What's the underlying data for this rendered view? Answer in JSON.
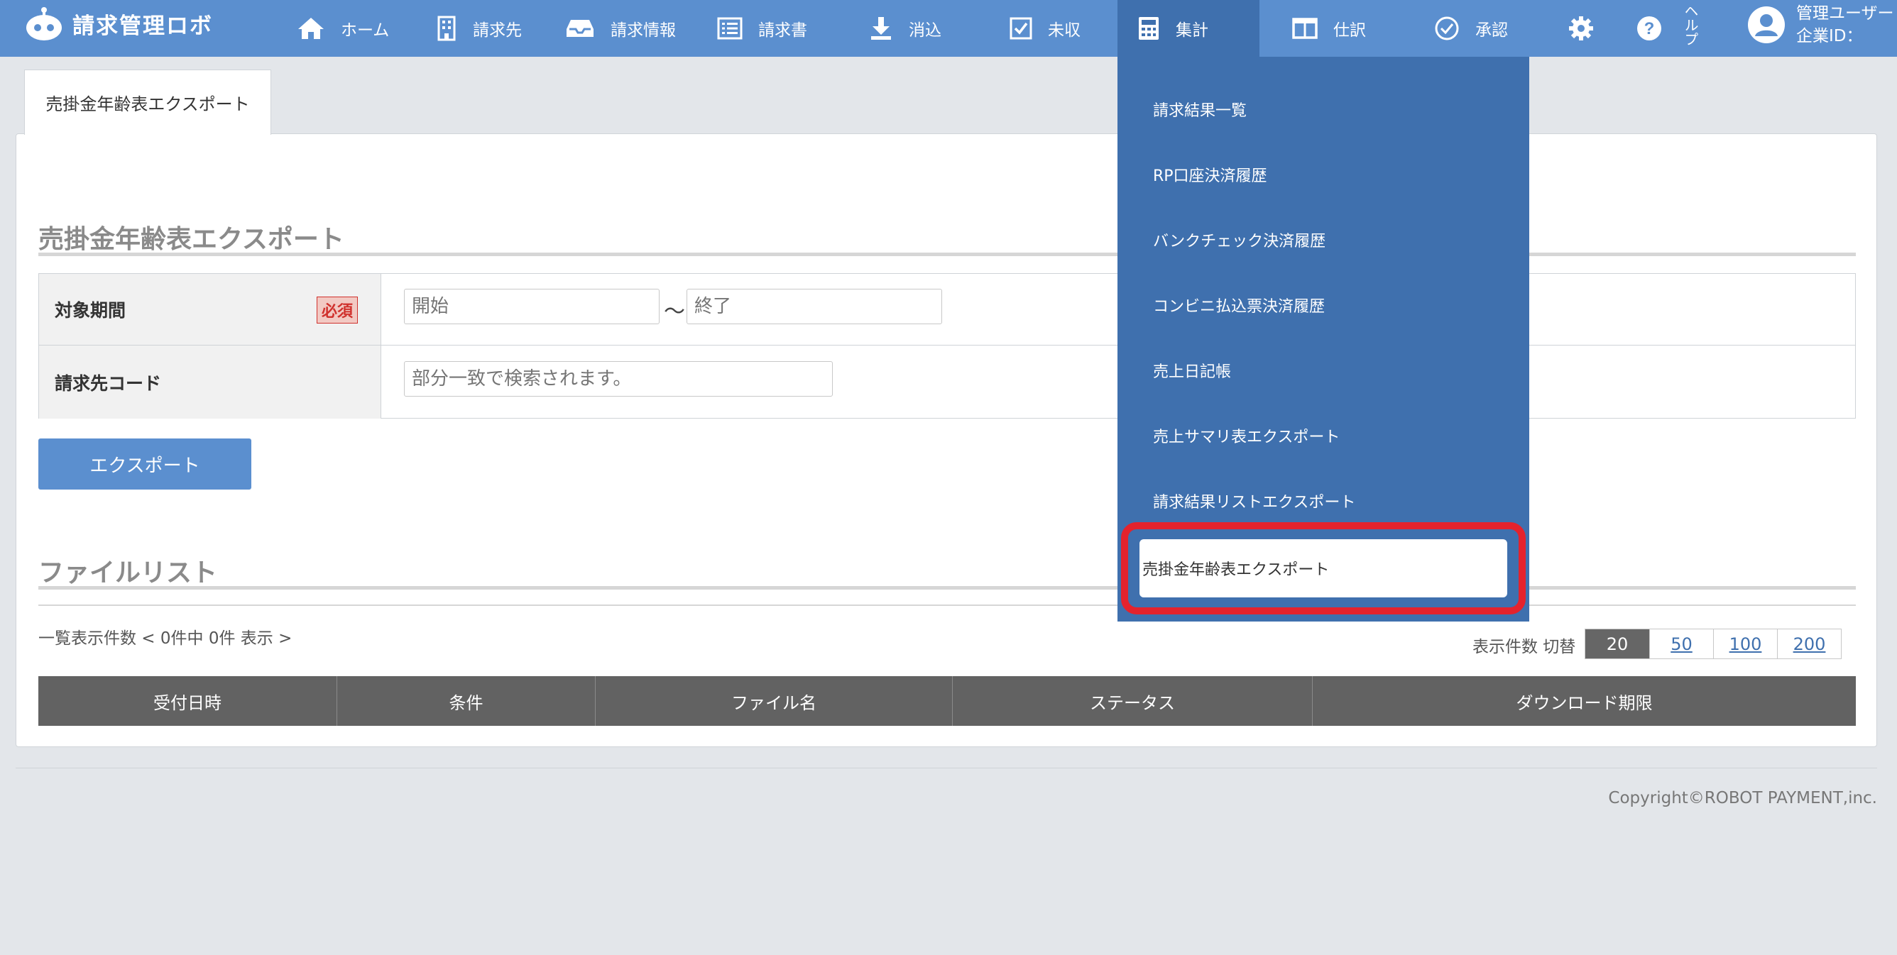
{
  "app": {
    "name": "請求管理ロボ"
  },
  "nav": {
    "items": [
      {
        "label": "ホーム",
        "icon": "home-icon"
      },
      {
        "label": "請求先",
        "icon": "building-icon"
      },
      {
        "label": "請求情報",
        "icon": "inbox-icon"
      },
      {
        "label": "請求書",
        "icon": "list-icon"
      },
      {
        "label": "消込",
        "icon": "download-icon"
      },
      {
        "label": "未収",
        "icon": "checkbox-icon"
      },
      {
        "label": "集計",
        "icon": "calculator-icon",
        "active": true
      },
      {
        "label": "仕訳",
        "icon": "columns-icon"
      },
      {
        "label": "承認",
        "icon": "check-circle-icon"
      }
    ],
    "help_label": "ヘルプ",
    "user_line1": "管理ユーザー",
    "user_line2": "企業ID："
  },
  "dropdown": {
    "items": [
      "請求結果一覧",
      "RP口座決済履歴",
      "バンクチェック決済履歴",
      "コンビニ払込票決済履歴",
      "売上日記帳",
      "売上サマリ表エクスポート",
      "請求結果リストエクスポート",
      "売掛金年齢表エクスポート"
    ],
    "highlighted_index": 7
  },
  "page": {
    "tab_label": "売掛金年齢表エクスポート",
    "section_title": "売掛金年齢表エクスポート",
    "form": {
      "period_label": "対象期間",
      "required_badge": "必須",
      "start_placeholder": "開始",
      "separator": "〜",
      "end_placeholder": "終了",
      "code_label": "請求先コード",
      "code_placeholder": "部分一致で検索されます。"
    },
    "export_button": "エクスポート",
    "file_list_title": "ファイルリスト",
    "list_info": "一覧表示件数 < 0件中 0件 表示 >",
    "pager_label": "表示件数 切替",
    "pager_options": [
      "20",
      "50",
      "100",
      "200"
    ],
    "table_headers": [
      "受付日時",
      "条件",
      "ファイル名",
      "ステータス",
      "ダウンロード期限"
    ]
  },
  "footer": {
    "copyright": "Copyright©ROBOT PAYMENT,inc."
  },
  "colors": {
    "nav_bg": "#5b8fcf",
    "nav_active": "#3f70ae",
    "highlight": "#e4232d"
  }
}
